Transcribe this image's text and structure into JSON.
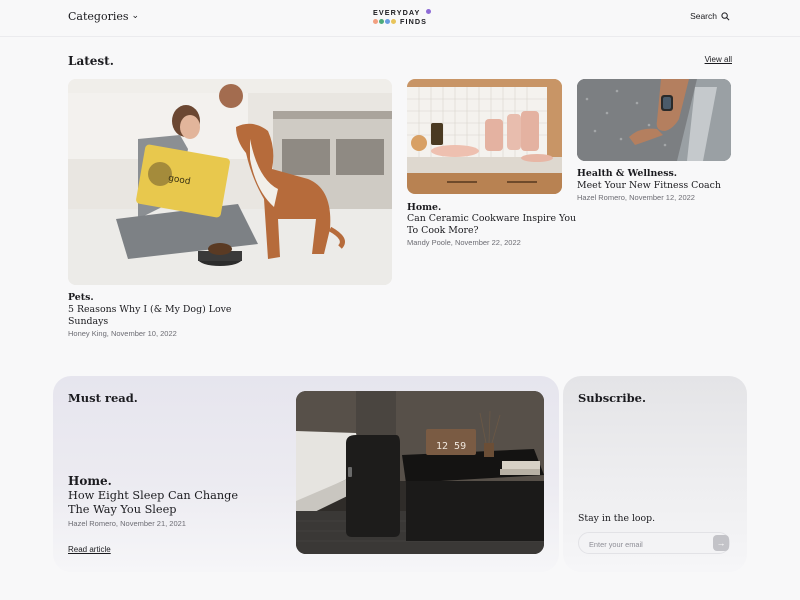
{
  "header": {
    "categories_label": "Categories",
    "logo_line1": "EVERYDAY",
    "logo_line2": "FINDS",
    "search_label": "Search"
  },
  "brand_colors": {
    "dot1": "#f2a081",
    "dot2": "#4caa7a",
    "dot3": "#6a9ce0",
    "dot4": "#e8c45b",
    "logo_dot": "#8d6bd6"
  },
  "latest": {
    "title": "Latest.",
    "view_all": "View all",
    "articles": [
      {
        "category": "Pets.",
        "title_line1": "5 Reasons Why I (& My Dog) Love",
        "title_line2": "Sundays",
        "meta": "Honey King, November 10, 2022"
      },
      {
        "category": "Home.",
        "title_line1": "Can Ceramic Cookware Inspire You",
        "title_line2": "To Cook More?",
        "meta": "Mandy Poole, November 22, 2022"
      },
      {
        "category": "Health & Wellness.",
        "title_line1": "Meet Your New Fitness Coach",
        "meta": "Hazel Romero, November 12, 2022"
      }
    ]
  },
  "must_read": {
    "title": "Must read.",
    "category": "Home.",
    "title_line1": "How Eight Sleep Can Change",
    "title_line2": "The Way You Sleep",
    "meta": "Hazel Romero, November 21, 2021",
    "link": "Read article",
    "clock_text": "12 59"
  },
  "subscribe": {
    "title": "Subscribe.",
    "tagline": "Stay in the loop.",
    "email_placeholder": "Enter your email",
    "submit_icon": "arrow-right-icon"
  }
}
